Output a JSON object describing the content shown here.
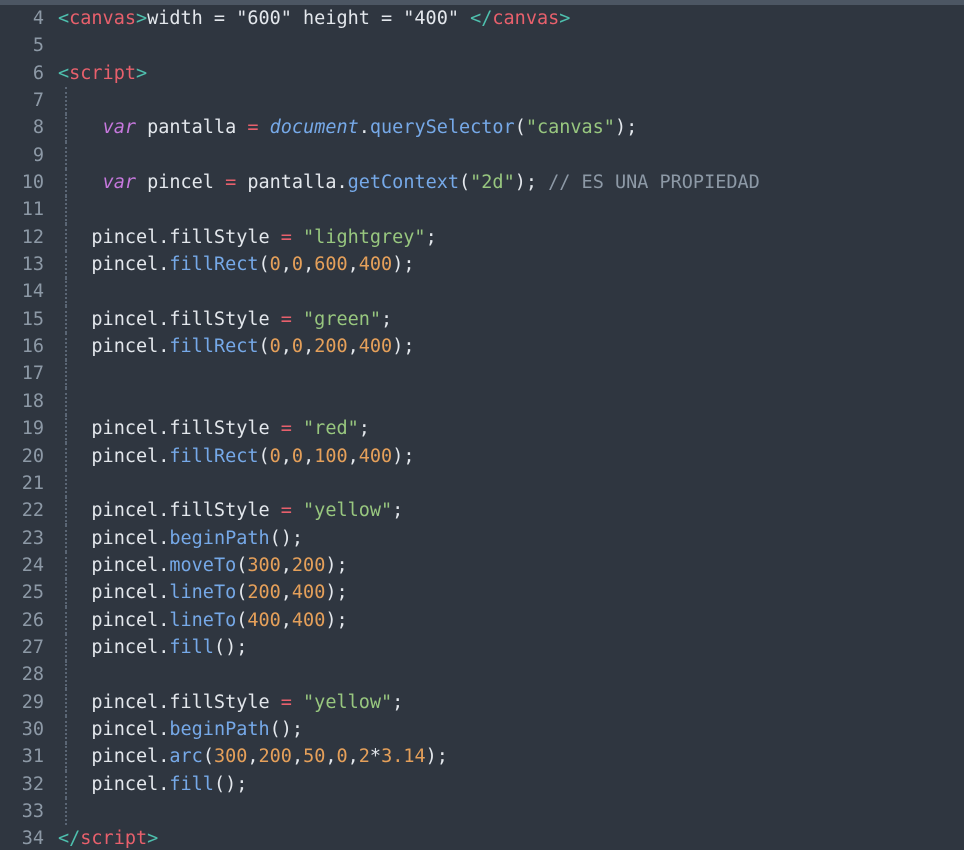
{
  "editor": {
    "background_color": "#2f3640",
    "gutter_color": "#8d99a6",
    "topbar_color": "#4c5663",
    "first_line_number": 4,
    "last_line_number": 34
  },
  "palette": {
    "bracket": "#4ec0ae",
    "tag": "#e8606c",
    "plain": "#e3e7ec",
    "keyword": "#c678dd",
    "global": "#76a9e8",
    "function": "#76a9e8",
    "string": "#98c77f",
    "number": "#e5a05a",
    "operator": "#e8606c",
    "comment": "#8d99a6"
  },
  "lines": [
    {
      "n": "4",
      "guide": false,
      "tokens": [
        {
          "t": "bracket",
          "v": "<"
        },
        {
          "t": "tag",
          "v": "canvas"
        },
        {
          "t": "bracket",
          "v": ">"
        },
        {
          "t": "plain",
          "v": "width = \"600\" height = \"400\" "
        },
        {
          "t": "bracket",
          "v": "</"
        },
        {
          "t": "tag",
          "v": "canvas"
        },
        {
          "t": "bracket",
          "v": ">"
        }
      ]
    },
    {
      "n": "5",
      "guide": false,
      "tokens": []
    },
    {
      "n": "6",
      "guide": false,
      "tokens": [
        {
          "t": "bracket",
          "v": "<"
        },
        {
          "t": "tag",
          "v": "script"
        },
        {
          "t": "bracket",
          "v": ">"
        }
      ]
    },
    {
      "n": "7",
      "guide": true,
      "tokens": []
    },
    {
      "n": "8",
      "guide": true,
      "tokens": [
        {
          "t": "plain",
          "v": "    "
        },
        {
          "t": "kw",
          "v": "var"
        },
        {
          "t": "plain",
          "v": " pantalla "
        },
        {
          "t": "op",
          "v": "="
        },
        {
          "t": "plain",
          "v": " "
        },
        {
          "t": "global",
          "v": "document"
        },
        {
          "t": "plain",
          "v": "."
        },
        {
          "t": "fn",
          "v": "querySelector"
        },
        {
          "t": "plain",
          "v": "("
        },
        {
          "t": "str",
          "v": "\"canvas\""
        },
        {
          "t": "plain",
          "v": ");"
        }
      ]
    },
    {
      "n": "9",
      "guide": true,
      "tokens": []
    },
    {
      "n": "10",
      "guide": true,
      "tokens": [
        {
          "t": "plain",
          "v": "    "
        },
        {
          "t": "kw",
          "v": "var"
        },
        {
          "t": "plain",
          "v": " pincel "
        },
        {
          "t": "op",
          "v": "="
        },
        {
          "t": "plain",
          "v": " pantalla."
        },
        {
          "t": "fn",
          "v": "getContext"
        },
        {
          "t": "plain",
          "v": "("
        },
        {
          "t": "str",
          "v": "\"2d\""
        },
        {
          "t": "plain",
          "v": "); "
        },
        {
          "t": "comment",
          "v": "// ES UNA PROPIEDAD"
        }
      ]
    },
    {
      "n": "11",
      "guide": true,
      "tokens": []
    },
    {
      "n": "12",
      "guide": true,
      "tokens": [
        {
          "t": "plain",
          "v": "   pincel.fillStyle "
        },
        {
          "t": "op",
          "v": "="
        },
        {
          "t": "plain",
          "v": " "
        },
        {
          "t": "str",
          "v": "\"lightgrey\""
        },
        {
          "t": "plain",
          "v": ";"
        }
      ]
    },
    {
      "n": "13",
      "guide": true,
      "tokens": [
        {
          "t": "plain",
          "v": "   pincel."
        },
        {
          "t": "fn",
          "v": "fillRect"
        },
        {
          "t": "plain",
          "v": "("
        },
        {
          "t": "num",
          "v": "0"
        },
        {
          "t": "plain",
          "v": ","
        },
        {
          "t": "num",
          "v": "0"
        },
        {
          "t": "plain",
          "v": ","
        },
        {
          "t": "num",
          "v": "600"
        },
        {
          "t": "plain",
          "v": ","
        },
        {
          "t": "num",
          "v": "400"
        },
        {
          "t": "plain",
          "v": ");"
        }
      ]
    },
    {
      "n": "14",
      "guide": true,
      "tokens": []
    },
    {
      "n": "15",
      "guide": true,
      "tokens": [
        {
          "t": "plain",
          "v": "   pincel.fillStyle "
        },
        {
          "t": "op",
          "v": "="
        },
        {
          "t": "plain",
          "v": " "
        },
        {
          "t": "str",
          "v": "\"green\""
        },
        {
          "t": "plain",
          "v": ";"
        }
      ]
    },
    {
      "n": "16",
      "guide": true,
      "tokens": [
        {
          "t": "plain",
          "v": "   pincel."
        },
        {
          "t": "fn",
          "v": "fillRect"
        },
        {
          "t": "plain",
          "v": "("
        },
        {
          "t": "num",
          "v": "0"
        },
        {
          "t": "plain",
          "v": ","
        },
        {
          "t": "num",
          "v": "0"
        },
        {
          "t": "plain",
          "v": ","
        },
        {
          "t": "num",
          "v": "200"
        },
        {
          "t": "plain",
          "v": ","
        },
        {
          "t": "num",
          "v": "400"
        },
        {
          "t": "plain",
          "v": ");"
        }
      ]
    },
    {
      "n": "17",
      "guide": true,
      "tokens": []
    },
    {
      "n": "18",
      "guide": true,
      "tokens": []
    },
    {
      "n": "19",
      "guide": true,
      "tokens": [
        {
          "t": "plain",
          "v": "   pincel.fillStyle "
        },
        {
          "t": "op",
          "v": "="
        },
        {
          "t": "plain",
          "v": " "
        },
        {
          "t": "str",
          "v": "\"red\""
        },
        {
          "t": "plain",
          "v": ";"
        }
      ]
    },
    {
      "n": "20",
      "guide": true,
      "tokens": [
        {
          "t": "plain",
          "v": "   pincel."
        },
        {
          "t": "fn",
          "v": "fillRect"
        },
        {
          "t": "plain",
          "v": "("
        },
        {
          "t": "num",
          "v": "0"
        },
        {
          "t": "plain",
          "v": ","
        },
        {
          "t": "num",
          "v": "0"
        },
        {
          "t": "plain",
          "v": ","
        },
        {
          "t": "num",
          "v": "100"
        },
        {
          "t": "plain",
          "v": ","
        },
        {
          "t": "num",
          "v": "400"
        },
        {
          "t": "plain",
          "v": ");"
        }
      ]
    },
    {
      "n": "21",
      "guide": true,
      "tokens": []
    },
    {
      "n": "22",
      "guide": true,
      "tokens": [
        {
          "t": "plain",
          "v": "   pincel.fillStyle "
        },
        {
          "t": "op",
          "v": "="
        },
        {
          "t": "plain",
          "v": " "
        },
        {
          "t": "str",
          "v": "\"yellow\""
        },
        {
          "t": "plain",
          "v": ";"
        }
      ]
    },
    {
      "n": "23",
      "guide": true,
      "tokens": [
        {
          "t": "plain",
          "v": "   pincel."
        },
        {
          "t": "fn",
          "v": "beginPath"
        },
        {
          "t": "plain",
          "v": "();"
        }
      ]
    },
    {
      "n": "24",
      "guide": true,
      "tokens": [
        {
          "t": "plain",
          "v": "   pincel."
        },
        {
          "t": "fn",
          "v": "moveTo"
        },
        {
          "t": "plain",
          "v": "("
        },
        {
          "t": "num",
          "v": "300"
        },
        {
          "t": "plain",
          "v": ","
        },
        {
          "t": "num",
          "v": "200"
        },
        {
          "t": "plain",
          "v": ");"
        }
      ]
    },
    {
      "n": "25",
      "guide": true,
      "tokens": [
        {
          "t": "plain",
          "v": "   pincel."
        },
        {
          "t": "fn",
          "v": "lineTo"
        },
        {
          "t": "plain",
          "v": "("
        },
        {
          "t": "num",
          "v": "200"
        },
        {
          "t": "plain",
          "v": ","
        },
        {
          "t": "num",
          "v": "400"
        },
        {
          "t": "plain",
          "v": ");"
        }
      ]
    },
    {
      "n": "26",
      "guide": true,
      "tokens": [
        {
          "t": "plain",
          "v": "   pincel."
        },
        {
          "t": "fn",
          "v": "lineTo"
        },
        {
          "t": "plain",
          "v": "("
        },
        {
          "t": "num",
          "v": "400"
        },
        {
          "t": "plain",
          "v": ","
        },
        {
          "t": "num",
          "v": "400"
        },
        {
          "t": "plain",
          "v": ");"
        }
      ]
    },
    {
      "n": "27",
      "guide": true,
      "tokens": [
        {
          "t": "plain",
          "v": "   pincel."
        },
        {
          "t": "fn",
          "v": "fill"
        },
        {
          "t": "plain",
          "v": "();"
        }
      ]
    },
    {
      "n": "28",
      "guide": true,
      "tokens": []
    },
    {
      "n": "29",
      "guide": true,
      "tokens": [
        {
          "t": "plain",
          "v": "   pincel.fillStyle "
        },
        {
          "t": "op",
          "v": "="
        },
        {
          "t": "plain",
          "v": " "
        },
        {
          "t": "str",
          "v": "\"yellow\""
        },
        {
          "t": "plain",
          "v": ";"
        }
      ]
    },
    {
      "n": "30",
      "guide": true,
      "tokens": [
        {
          "t": "plain",
          "v": "   pincel."
        },
        {
          "t": "fn",
          "v": "beginPath"
        },
        {
          "t": "plain",
          "v": "();"
        }
      ]
    },
    {
      "n": "31",
      "guide": true,
      "tokens": [
        {
          "t": "plain",
          "v": "   pincel."
        },
        {
          "t": "fn",
          "v": "arc"
        },
        {
          "t": "plain",
          "v": "("
        },
        {
          "t": "num",
          "v": "300"
        },
        {
          "t": "plain",
          "v": ","
        },
        {
          "t": "num",
          "v": "200"
        },
        {
          "t": "plain",
          "v": ","
        },
        {
          "t": "num",
          "v": "50"
        },
        {
          "t": "plain",
          "v": ","
        },
        {
          "t": "num",
          "v": "0"
        },
        {
          "t": "plain",
          "v": ","
        },
        {
          "t": "num",
          "v": "2"
        },
        {
          "t": "plain",
          "v": "*"
        },
        {
          "t": "num",
          "v": "3.14"
        },
        {
          "t": "plain",
          "v": ");"
        }
      ]
    },
    {
      "n": "32",
      "guide": true,
      "tokens": [
        {
          "t": "plain",
          "v": "   pincel."
        },
        {
          "t": "fn",
          "v": "fill"
        },
        {
          "t": "plain",
          "v": "();"
        }
      ]
    },
    {
      "n": "33",
      "guide": true,
      "tokens": []
    },
    {
      "n": "34",
      "guide": false,
      "tokens": [
        {
          "t": "bracket",
          "v": "</"
        },
        {
          "t": "tag",
          "v": "script"
        },
        {
          "t": "bracket",
          "v": ">"
        }
      ]
    }
  ]
}
